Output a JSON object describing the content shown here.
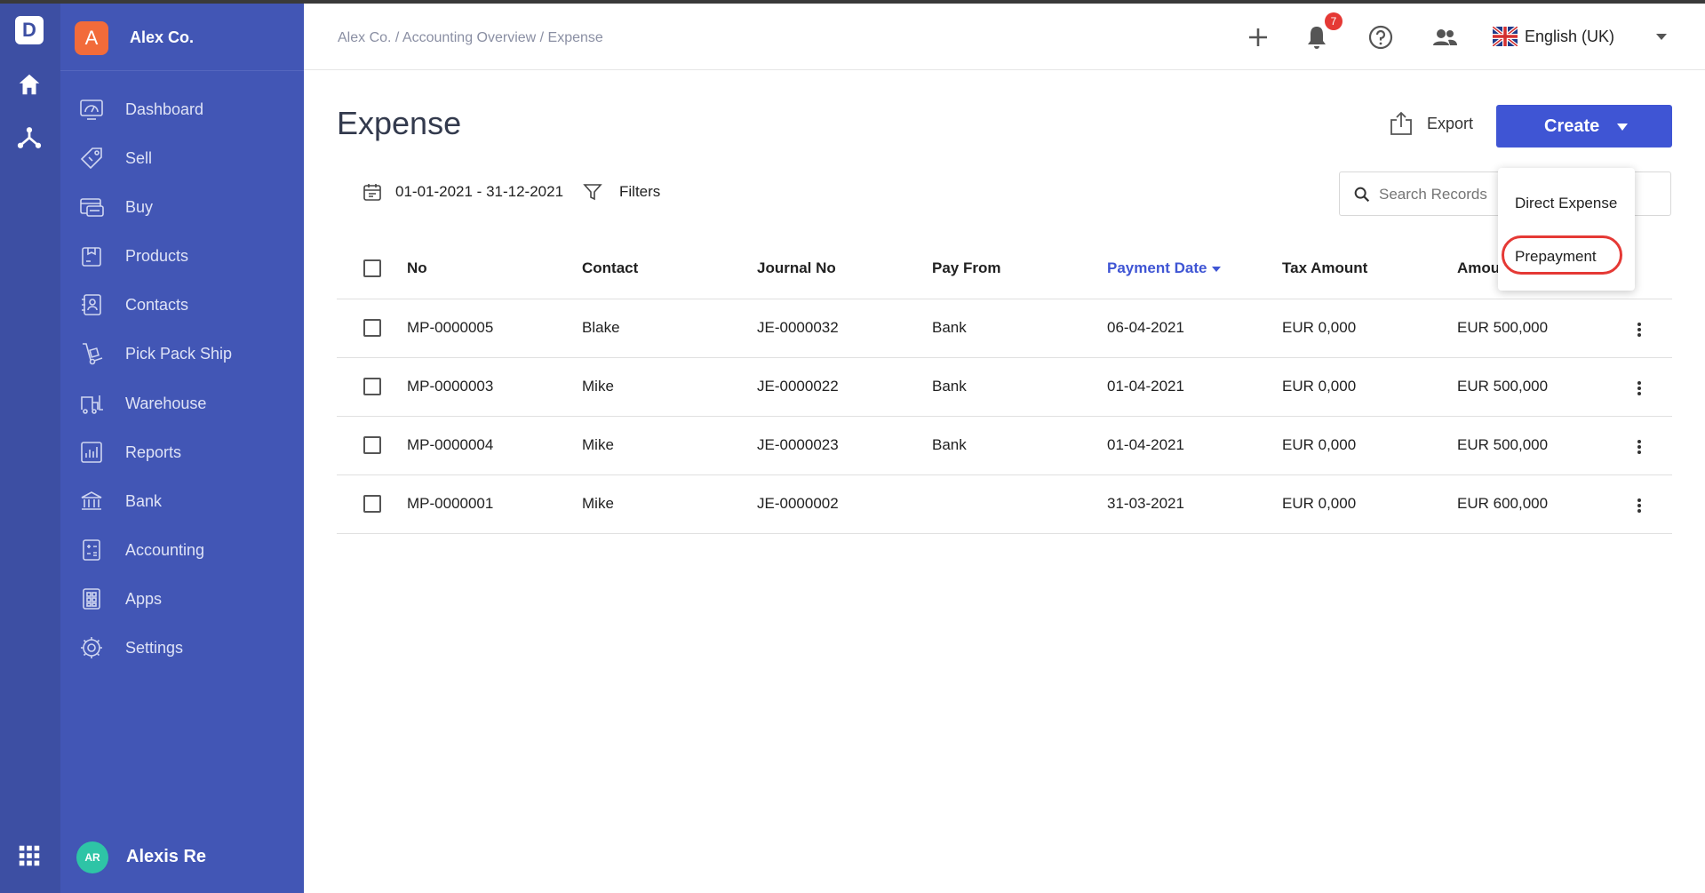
{
  "app": {
    "logo_letter": "D",
    "org_initial": "A",
    "org_name": "Alex Co."
  },
  "sidebar": {
    "items": [
      {
        "label": "Dashboard",
        "icon": "dashboard-icon"
      },
      {
        "label": "Sell",
        "icon": "sell-tag-icon"
      },
      {
        "label": "Buy",
        "icon": "buy-card-icon"
      },
      {
        "label": "Products",
        "icon": "products-box-icon"
      },
      {
        "label": "Contacts",
        "icon": "contacts-book-icon"
      },
      {
        "label": "Pick Pack Ship",
        "icon": "hand-truck-icon"
      },
      {
        "label": "Warehouse",
        "icon": "warehouse-forklift-icon"
      },
      {
        "label": "Reports",
        "icon": "reports-chart-icon"
      },
      {
        "label": "Bank",
        "icon": "bank-icon"
      },
      {
        "label": "Accounting",
        "icon": "calculator-icon"
      },
      {
        "label": "Apps",
        "icon": "apps-grid-icon"
      },
      {
        "label": "Settings",
        "icon": "gear-icon"
      }
    ],
    "user": {
      "initials": "AR",
      "name": "Alexis Re"
    }
  },
  "header": {
    "breadcrumb": "Alex Co. / Accounting Overview / Expense",
    "notification_count": "7",
    "language": "English (UK)"
  },
  "page": {
    "title": "Expense",
    "export_label": "Export",
    "create_label": "Create",
    "date_range": "01-01-2021 - 31-12-2021",
    "filters_label": "Filters",
    "search_placeholder": "Search Records"
  },
  "create_menu": {
    "items": [
      "Direct Expense",
      "Prepayment"
    ],
    "highlighted": "Prepayment"
  },
  "table": {
    "columns": [
      "No",
      "Contact",
      "Journal No",
      "Pay From",
      "Payment Date",
      "Tax Amount",
      "Amou"
    ],
    "sorted_column": "Payment Date",
    "rows": [
      {
        "no": "MP-0000005",
        "contact": "Blake",
        "journal": "JE-0000032",
        "pay_from": "Bank",
        "date": "06-04-2021",
        "tax": "EUR  0,000",
        "amount": "EUR  500,000"
      },
      {
        "no": "MP-0000003",
        "contact": "Mike",
        "journal": "JE-0000022",
        "pay_from": "Bank",
        "date": "01-04-2021",
        "tax": "EUR  0,000",
        "amount": "EUR  500,000"
      },
      {
        "no": "MP-0000004",
        "contact": "Mike",
        "journal": "JE-0000023",
        "pay_from": "Bank",
        "date": "01-04-2021",
        "tax": "EUR  0,000",
        "amount": "EUR  500,000"
      },
      {
        "no": "MP-0000001",
        "contact": "Mike",
        "journal": "JE-0000002",
        "pay_from": "",
        "date": "31-03-2021",
        "tax": "EUR  0,000",
        "amount": "EUR  600,000"
      }
    ]
  },
  "colors": {
    "rail": "#3d4fa3",
    "sidebar": "#4256b5",
    "accent": "#3f55d4",
    "org_badge": "#f26b3a",
    "avatar": "#2ec4a6",
    "highlight_ring": "#e53935"
  }
}
